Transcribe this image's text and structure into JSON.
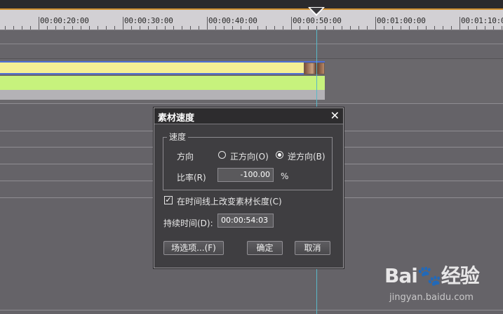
{
  "ruler": {
    "labels": [
      "00:00:20:00",
      "00:00:30:00",
      "00:00:40:00",
      "00:00:50:00",
      "00:01:00:00",
      "00:01:10:0"
    ]
  },
  "dialog": {
    "title": "素材速度",
    "close_glyph": "✕",
    "group_label": "速度",
    "direction_label": "方向",
    "forward_label": "正方向(O)",
    "reverse_label": "逆方向(B)",
    "selected_direction": "reverse",
    "rate_label": "比率(R)",
    "rate_value": "-100.00",
    "rate_unit": "%",
    "change_length_checked": true,
    "change_length_label": "在时间线上改变素材长度(C)",
    "duration_label": "持续时间(D):",
    "duration_value": "00:00:54:03",
    "field_options_button": "场选项...(F)",
    "ok_button": "确定",
    "cancel_button": "取消"
  },
  "watermark": {
    "logo_text": "Bai🐾经验",
    "url": "jingyan.baidu.com"
  },
  "colors": {
    "clip_video": "#f4ef94",
    "clip_audio": "#c7f27d",
    "playhead_line": "#59b8c8",
    "selection_border": "#4f6fd6"
  }
}
